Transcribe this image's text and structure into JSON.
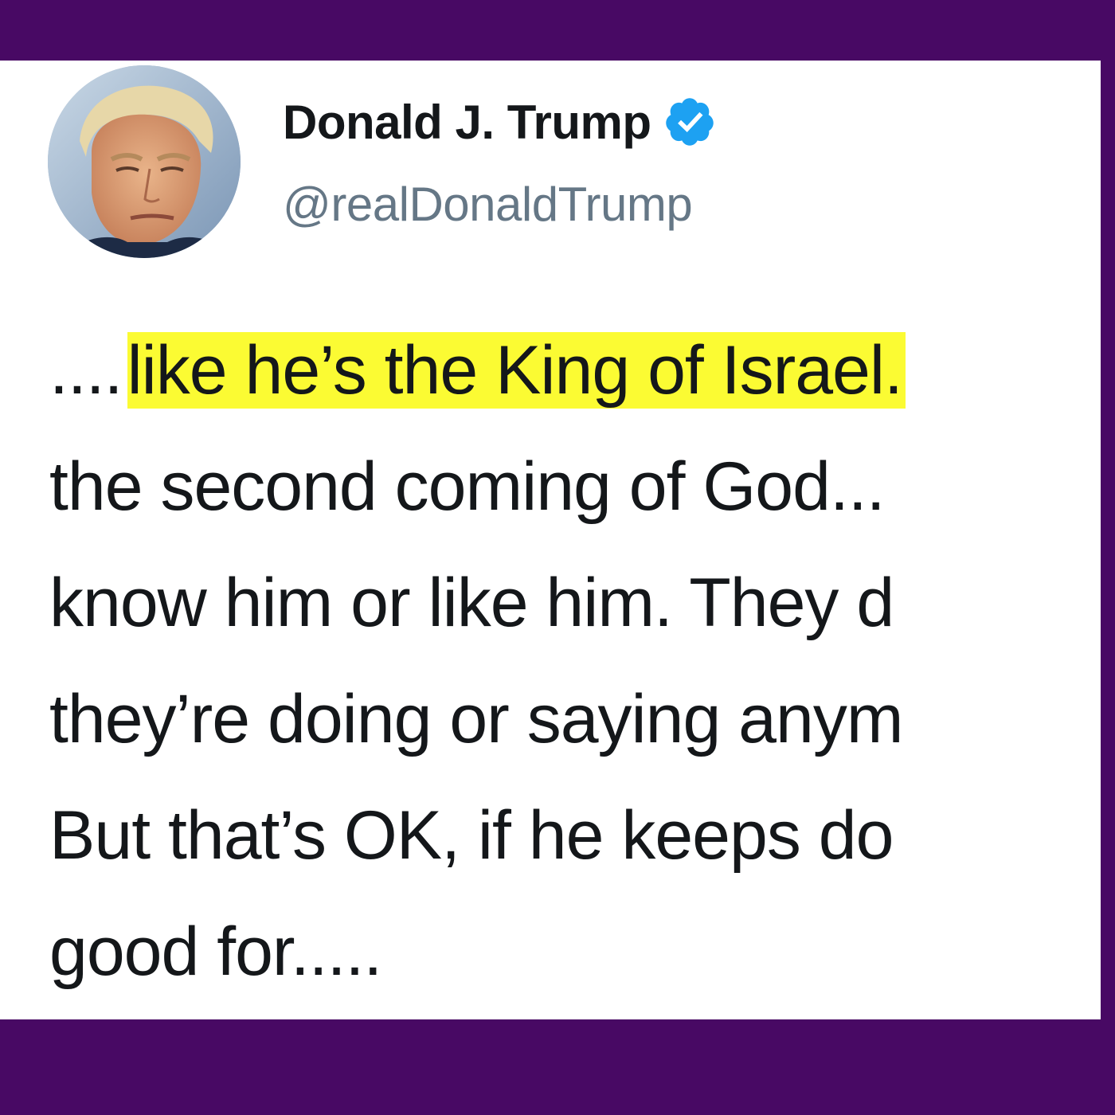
{
  "colors": {
    "frame": "#480964",
    "card": "#ffffff",
    "text": "#14171a",
    "handle": "#657786",
    "verified": "#1da1f2",
    "highlight": "#fbfb33"
  },
  "tweet": {
    "author": {
      "display_name": "Donald J. Trump",
      "handle": "@realDonaldTrump",
      "verified_icon": "verified-badge-icon",
      "avatar": "profile-photo"
    },
    "lines": [
      {
        "prefix": "....",
        "highlight": "like he’s the King of Israel."
      },
      {
        "text": "the second coming of God..."
      },
      {
        "text": "know him or like him. They d"
      },
      {
        "text": "they’re doing or saying anym"
      },
      {
        "text": "But that’s OK, if he keeps do"
      },
      {
        "text": "good for....."
      }
    ]
  }
}
